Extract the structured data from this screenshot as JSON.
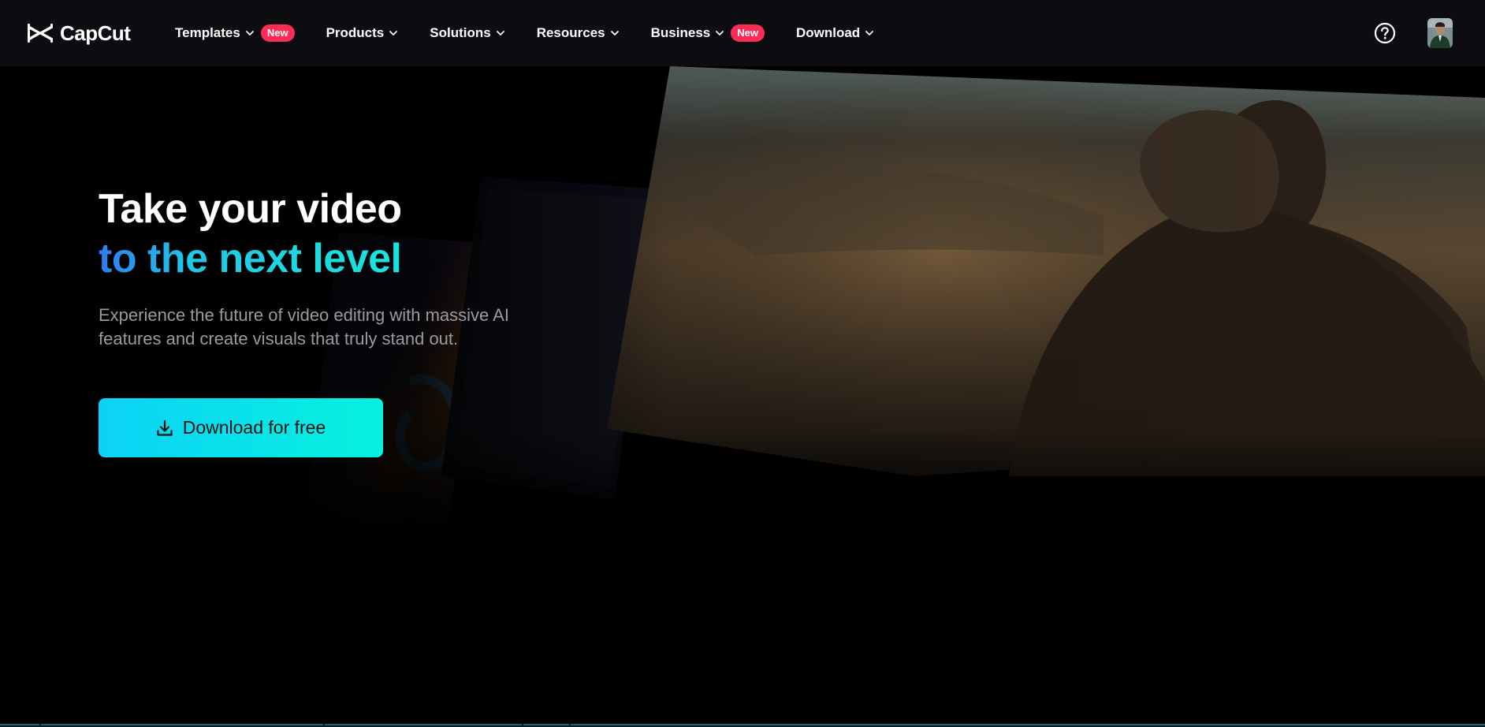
{
  "brand": {
    "name": "CapCut"
  },
  "nav": {
    "items": [
      {
        "label": "Templates",
        "badge": "New"
      },
      {
        "label": "Products"
      },
      {
        "label": "Solutions"
      },
      {
        "label": "Resources"
      },
      {
        "label": "Business",
        "badge": "New"
      },
      {
        "label": "Download"
      }
    ]
  },
  "hero": {
    "headline_line1": "Take your video",
    "headline_line2": "to the next level",
    "subtitle": "Experience the future of video editing with massive AI features and create visuals that truly stand out.",
    "cta_label": "Download for free"
  },
  "colors": {
    "nav_bg": "#0c0c11",
    "badge_new": "#fe2c55",
    "cta_start": "#0bd2f6",
    "cta_end": "#07f1de",
    "headline_gradient_start": "#2f7bf0",
    "headline_gradient_end": "#17e6dc",
    "subtitle_text": "#9a9aa3"
  },
  "icons": {
    "logo": "capcut-logo-icon",
    "chevron": "chevron-down-icon",
    "help": "help-circle-icon",
    "download": "download-icon"
  }
}
